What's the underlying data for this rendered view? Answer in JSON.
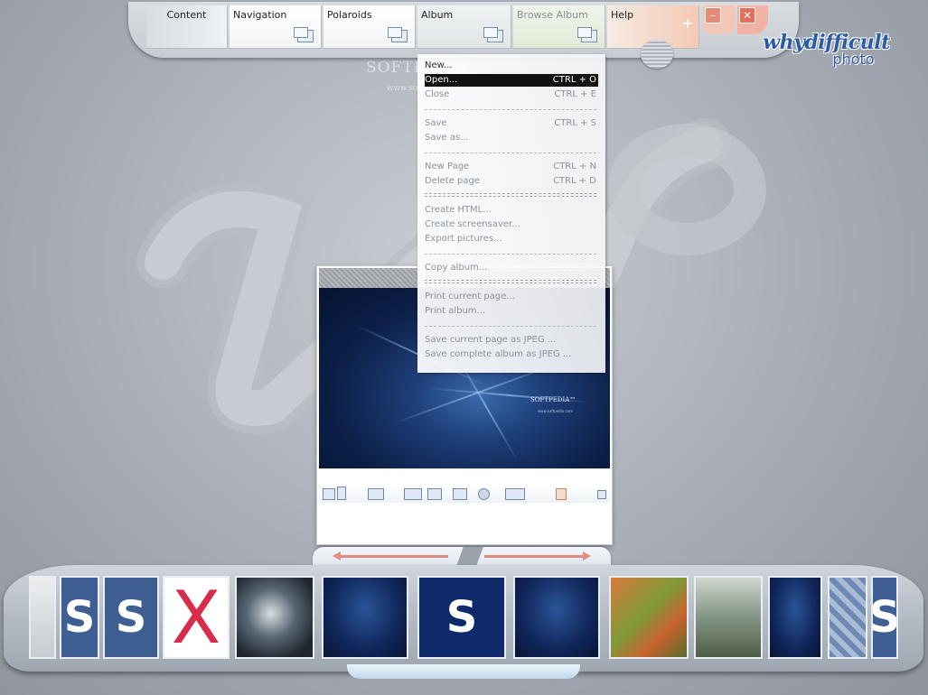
{
  "watermark": {
    "text": "SOFTPEDIA™",
    "url": "www.softpedia.com"
  },
  "tabs": [
    {
      "id": "content",
      "label": "Content"
    },
    {
      "id": "navigation",
      "label": "Navigation"
    },
    {
      "id": "polaroids",
      "label": "Polaroids"
    },
    {
      "id": "album",
      "label": "Album"
    },
    {
      "id": "browse",
      "label": "Browse Album"
    },
    {
      "id": "help",
      "label": "Help"
    }
  ],
  "window_buttons": {
    "add": "+",
    "minimize": "–",
    "close": "✕"
  },
  "brand": {
    "line1": "whydifficult",
    "line2": "photo"
  },
  "menu": {
    "items": [
      {
        "label": "New...",
        "shortcut": "",
        "enabled": true
      },
      {
        "label": "Open...",
        "shortcut": "CTRL + O",
        "enabled": true,
        "highlighted": true
      },
      {
        "label": "Close",
        "shortcut": "CTRL + E",
        "enabled": false
      },
      {
        "label": "Save",
        "shortcut": "CTRL + S",
        "enabled": false
      },
      {
        "label": "Save as...",
        "shortcut": "",
        "enabled": false
      },
      {
        "label": "New Page",
        "shortcut": "CTRL + N",
        "enabled": false
      },
      {
        "label": "Delete page",
        "shortcut": "CTRL + D",
        "enabled": false
      },
      {
        "label": "Create HTML...",
        "shortcut": "",
        "enabled": false
      },
      {
        "label": "Create screensaver...",
        "shortcut": "",
        "enabled": false
      },
      {
        "label": "Export pictures...",
        "shortcut": "",
        "enabled": false
      },
      {
        "label": "Copy album...",
        "shortcut": "",
        "enabled": false
      },
      {
        "label": "Print current page...",
        "shortcut": "",
        "enabled": false
      },
      {
        "label": "Print album...",
        "shortcut": "",
        "enabled": false
      },
      {
        "label": "Save current page as JPEG ...",
        "shortcut": "",
        "enabled": false
      },
      {
        "label": "Save complete album as JPEG ...",
        "shortcut": "",
        "enabled": false
      }
    ]
  },
  "preview": {
    "image_text": "SOFTPEDIA™",
    "image_url": "www.softpedia.com"
  },
  "filmstrip": {
    "thumbs": [
      {
        "kind": "gray",
        "label": ""
      },
      {
        "kind": "blue",
        "label": "S"
      },
      {
        "kind": "blue",
        "label": "S"
      },
      {
        "kind": "x",
        "label": "X"
      },
      {
        "kind": "frost",
        "label": ""
      },
      {
        "kind": "dark",
        "label": ""
      },
      {
        "kind": "navy",
        "label": "S"
      },
      {
        "kind": "dark",
        "label": ""
      },
      {
        "kind": "leaf",
        "label": ""
      },
      {
        "kind": "forest",
        "label": ""
      },
      {
        "kind": "dark",
        "label": ""
      },
      {
        "kind": "mosaic",
        "label": ""
      },
      {
        "kind": "blue",
        "label": "S"
      }
    ]
  }
}
